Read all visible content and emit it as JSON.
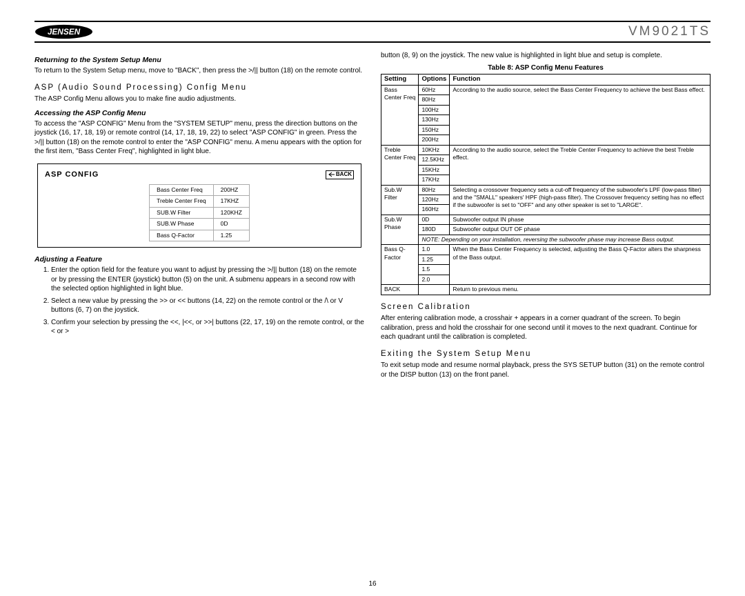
{
  "header": {
    "brand": "JENSEN",
    "model": "VM9021TS"
  },
  "left": {
    "return_heading": "Returning to the System Setup Menu",
    "return_text": "To return to the System Setup menu, move to \"BACK\", then press the >/|| button (18) on the remote control.",
    "asp_heading": "ASP (Audio Sound Processing) Config Menu",
    "asp_intro": "The ASP Config Menu allows you to make fine audio adjustments.",
    "access_heading": "Accessing the ASP Config Menu",
    "access_text": "To access the \"ASP CONFIG\" Menu from the \"SYSTEM SETUP\" menu, press the direction buttons on the joystick (16, 17, 18, 19) or remote control (14, 17, 18, 19, 22) to select \"ASP CONFIG\" in green. Press the >/|| button (18) on the remote control to enter the \"ASP CONFIG\" menu. A menu appears with the option for the first item, \"Bass Center Freq\", highlighted in light blue.",
    "asp_box_title": "ASP CONFIG",
    "asp_back": "BACK",
    "asp_rows": [
      {
        "label": "Bass Center Freq",
        "val": "200HZ"
      },
      {
        "label": "Treble Center Freq",
        "val": "17KHZ"
      },
      {
        "label": "SUB.W Filter",
        "val": "120KHZ"
      },
      {
        "label": "SUB.W Phase",
        "val": "0D"
      },
      {
        "label": "Bass Q-Factor",
        "val": "1.25"
      }
    ],
    "adjust_heading": "Adjusting a Feature",
    "adjust_steps": [
      "Enter the option field for the feature you want to adjust by pressing the >/|| button (18) on the remote or by pressing the ENTER (joystick) button (5) on the unit. A submenu appears in a second row with the selected option highlighted in light blue.",
      "Select a new value by pressing the >> or << buttons (14, 22) on the remote control or the /\\ or V buttons (6, 7) on the joystick.",
      "Confirm your selection by pressing the <<, |<<, or >>| buttons (22, 17, 19) on the remote control, or the < or >"
    ]
  },
  "right": {
    "cont_text": "button (8, 9) on the joystick. The new value is highlighted in light blue and setup is complete.",
    "table_caption": "Table 8: ASP Config Menu Features",
    "th": {
      "setting": "Setting",
      "options": "Options",
      "function": "Function"
    },
    "rows": [
      {
        "setting": "Bass Center Freq",
        "options": [
          "60Hz",
          "80Hz",
          "100Hz",
          "130Hz",
          "150Hz",
          "200Hz"
        ],
        "function": "According to the audio source, select the Bass Center Frequency to achieve the best Bass effect."
      },
      {
        "setting": "Treble Center Freq",
        "options": [
          "10KHz",
          "12.5KHz",
          "15KHz",
          "17KHz"
        ],
        "function": "According to the audio source, select the Treble Center Frequency to achieve the best Treble effect."
      },
      {
        "setting": "Sub.W Filter",
        "options": [
          "80Hz",
          "120Hz",
          "160Hz"
        ],
        "function": "Selecting a crossover frequency sets a cut-off frequency of the subwoofer's LPF (low-pass filter) and the \"SMALL\" speakers' HPF (high-pass filter). The Crossover frequency setting has no effect if the subwoofer is set to \"OFF\" and any other speaker is set to \"LARGE\"."
      },
      {
        "setting": "Sub.W Phase",
        "options": [
          "0D",
          "180D"
        ],
        "function_per_option": [
          "Subwoofer output IN phase",
          "Subwoofer output OUT OF phase"
        ],
        "note": "NOTE: Depending on your installation, reversing the subwoofer phase may increase Bass output."
      },
      {
        "setting": "Bass Q-Factor",
        "options": [
          "1.0",
          "1.25",
          "1.5",
          "2.0"
        ],
        "function": "When the Bass Center Frequency is selected, adjusting the Bass Q-Factor alters the sharpness of the Bass output."
      },
      {
        "setting": "BACK",
        "options": [
          ""
        ],
        "function": "Return to previous menu."
      }
    ],
    "screen_cal_heading": "Screen Calibration",
    "screen_cal_text": "After entering calibration mode, a crosshair + appears in a corner quadrant of the screen. To begin calibration, press and hold the crosshair for one second until it moves to the next quadrant. Continue for each quadrant until the calibration is completed.",
    "exit_heading": "Exiting the System Setup Menu",
    "exit_text": "To exit setup mode and resume normal playback, press the SYS SETUP button (31) on the remote control or the DISP button (13) on the front panel."
  },
  "page_number": "16"
}
